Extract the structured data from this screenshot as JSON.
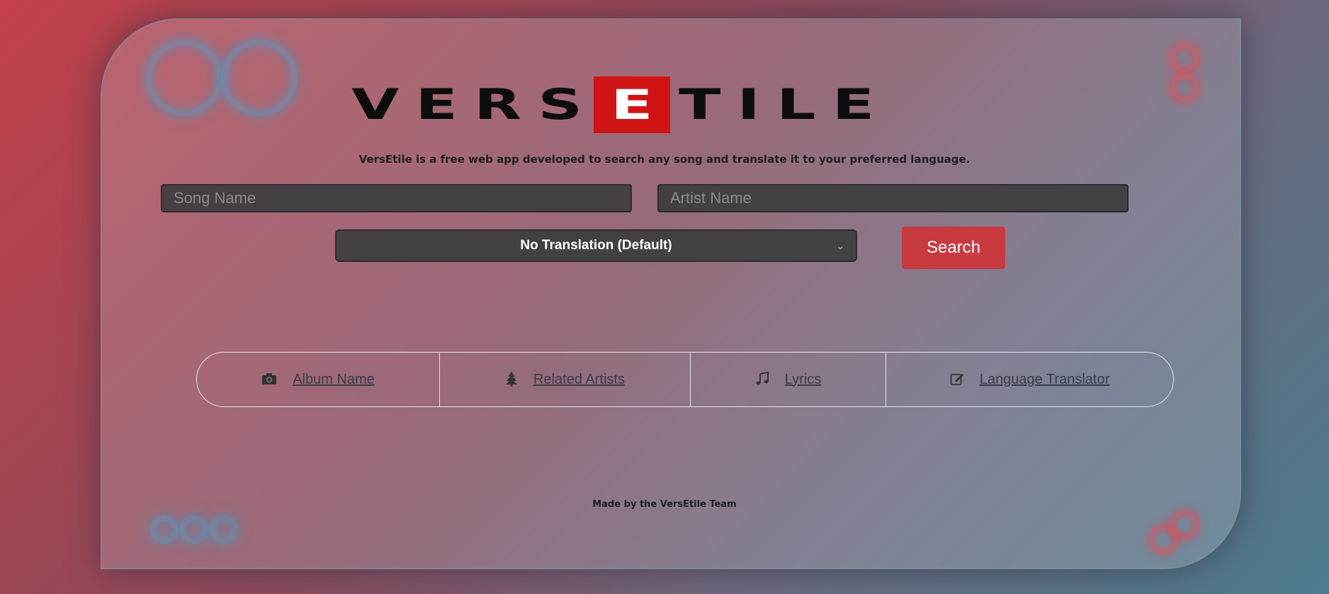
{
  "logo": {
    "left": "VERS",
    "middle": "E",
    "right": "TILE"
  },
  "tagline": "VersEtile is a free web app developed to search any song and translate it to your preferred language.",
  "form": {
    "song_placeholder": "Song Name",
    "artist_placeholder": "Artist Name",
    "translation_selected": "No Translation (Default)",
    "search_label": "Search"
  },
  "nav": {
    "items": [
      {
        "label": "Album Name",
        "icon": "camera-icon"
      },
      {
        "label": "Related Artists",
        "icon": "tree-icon"
      },
      {
        "label": "Lyrics",
        "icon": "music-icon"
      },
      {
        "label": "Language Translator",
        "icon": "edit-icon"
      }
    ]
  },
  "footer": "Made by the VersEtile Team",
  "colors": {
    "accent": "#c83a40",
    "logo_red": "#d01414",
    "input_bg": "#3c3c3e"
  }
}
